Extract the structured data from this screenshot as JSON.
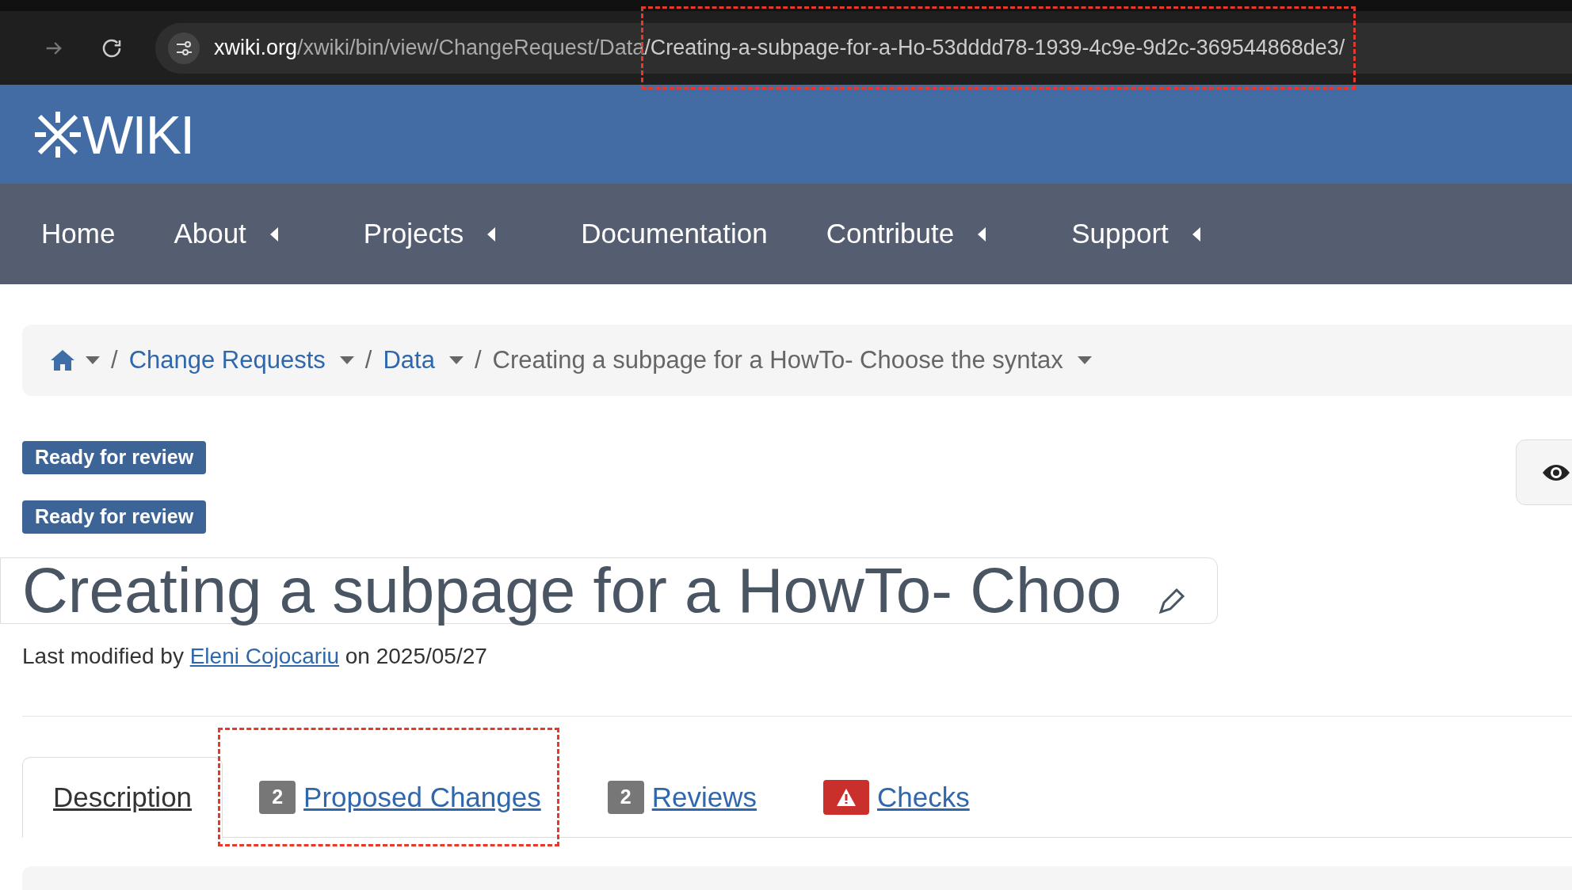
{
  "browser": {
    "url_prefix": "xwiki.org/xwiki/bin/view/ChangeRequest/Data",
    "url_highlighted": "/Creating-a-subpage-for-a-Ho-53dddd78-1939-4c9e-9d2c-369544868de3/"
  },
  "header": {
    "logo": "WIKI"
  },
  "nav": [
    {
      "label": "Home",
      "has_menu": false
    },
    {
      "label": "About",
      "has_menu": true
    },
    {
      "label": "Projects",
      "has_menu": true
    },
    {
      "label": "Documentation",
      "has_menu": false
    },
    {
      "label": "Contribute",
      "has_menu": true
    },
    {
      "label": "Support",
      "has_menu": true
    }
  ],
  "breadcrumb": [
    {
      "separator": "/",
      "label": "Change Requests",
      "kind": "link"
    },
    {
      "separator": "/",
      "label": "Data",
      "kind": "link"
    },
    {
      "separator": "/",
      "label": "Creating a subpage for a HowTo- Choose the syntax",
      "kind": "current"
    }
  ],
  "badges": [
    "Ready for review",
    "Ready for review"
  ],
  "title": "Creating a subpage for a HowTo- Choo",
  "modified": {
    "prefix": "Last modified by",
    "author": "Eleni Cojocariu",
    "suffix": "on 2025/05/27"
  },
  "tabs": [
    {
      "label": "Description",
      "selected": true,
      "highlighted": false
    },
    {
      "label": "Proposed Changes",
      "count": "2",
      "selected": false,
      "highlighted": true
    },
    {
      "label": "Reviews",
      "count": "2",
      "selected": false,
      "highlighted": false
    },
    {
      "label": "Checks",
      "warning": true,
      "selected": false,
      "highlighted": false
    }
  ]
}
